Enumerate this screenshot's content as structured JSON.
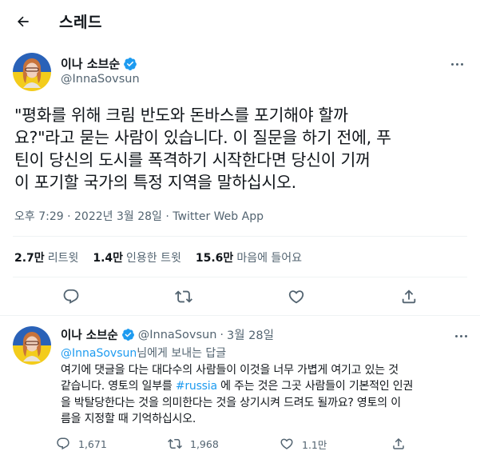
{
  "header": {
    "title": "스레드"
  },
  "tweet": {
    "author_name": "이나 소브순",
    "author_handle": "@InnaSovsun",
    "text_lines": [
      "\"평화를 위해 크림 반도와 돈바스를 포기해야 할까",
      "요?\"라고 묻는 사람이 있습니다. 이 질문을 하기 전에, 푸",
      "틴이 당신의 도시를 폭격하기 시작한다면 당신이 기꺼",
      "이 포기할 국가의 특정 지역을 말하십시오."
    ],
    "time": "오후 7:29",
    "sep1": "·",
    "date": "2022년 3월 28일",
    "sep2": "·",
    "source": "Twitter Web App"
  },
  "stats": {
    "retweets_count": "2.7만",
    "retweets_label": "리트윗",
    "quotes_count": "1.4만",
    "quotes_label": "인용한 트윗",
    "likes_count": "15.6만",
    "likes_label": "마음에 들어요"
  },
  "reply": {
    "author_name": "이나 소브순",
    "author_handle": "@InnaSovsun",
    "sep": "·",
    "date": "3월 28일",
    "reply_to_mention": "@InnaSovsun",
    "reply_to_suffix": "님에게 보내는 답글",
    "line1": "여기에 댓글을 다는 대다수의 사람들이 이것을 너무 가볍게 여기고 있는 것",
    "line2_pre": "같습니다. 영토의 일부를 ",
    "hashtag": "#russia",
    "line2_post": " 에 주는 것은 그곳 사람들이 기본적인 인권",
    "line3": "을 박탈당한다는 것을 의미한다는 것을 상기시켜 드려도 될까요? 영토의 이",
    "line4": "름을 지정할 때 기억하십시오.",
    "replies_count": "1,671",
    "retweets_count": "1,968",
    "likes_count": "1.1만"
  },
  "colors": {
    "accent": "#1d9bf0",
    "secondary_text": "#536471",
    "divider": "#eff3f4",
    "verified": "#1d9bf0",
    "flag_blue": "#2a62b8",
    "flag_yellow": "#f3cc1c"
  },
  "icons": {
    "back": "arrow-left-icon",
    "verified": "verified-badge-icon",
    "more": "more-dots-icon",
    "reply": "reply-icon",
    "retweet": "retweet-icon",
    "like": "heart-icon",
    "share": "share-icon"
  }
}
